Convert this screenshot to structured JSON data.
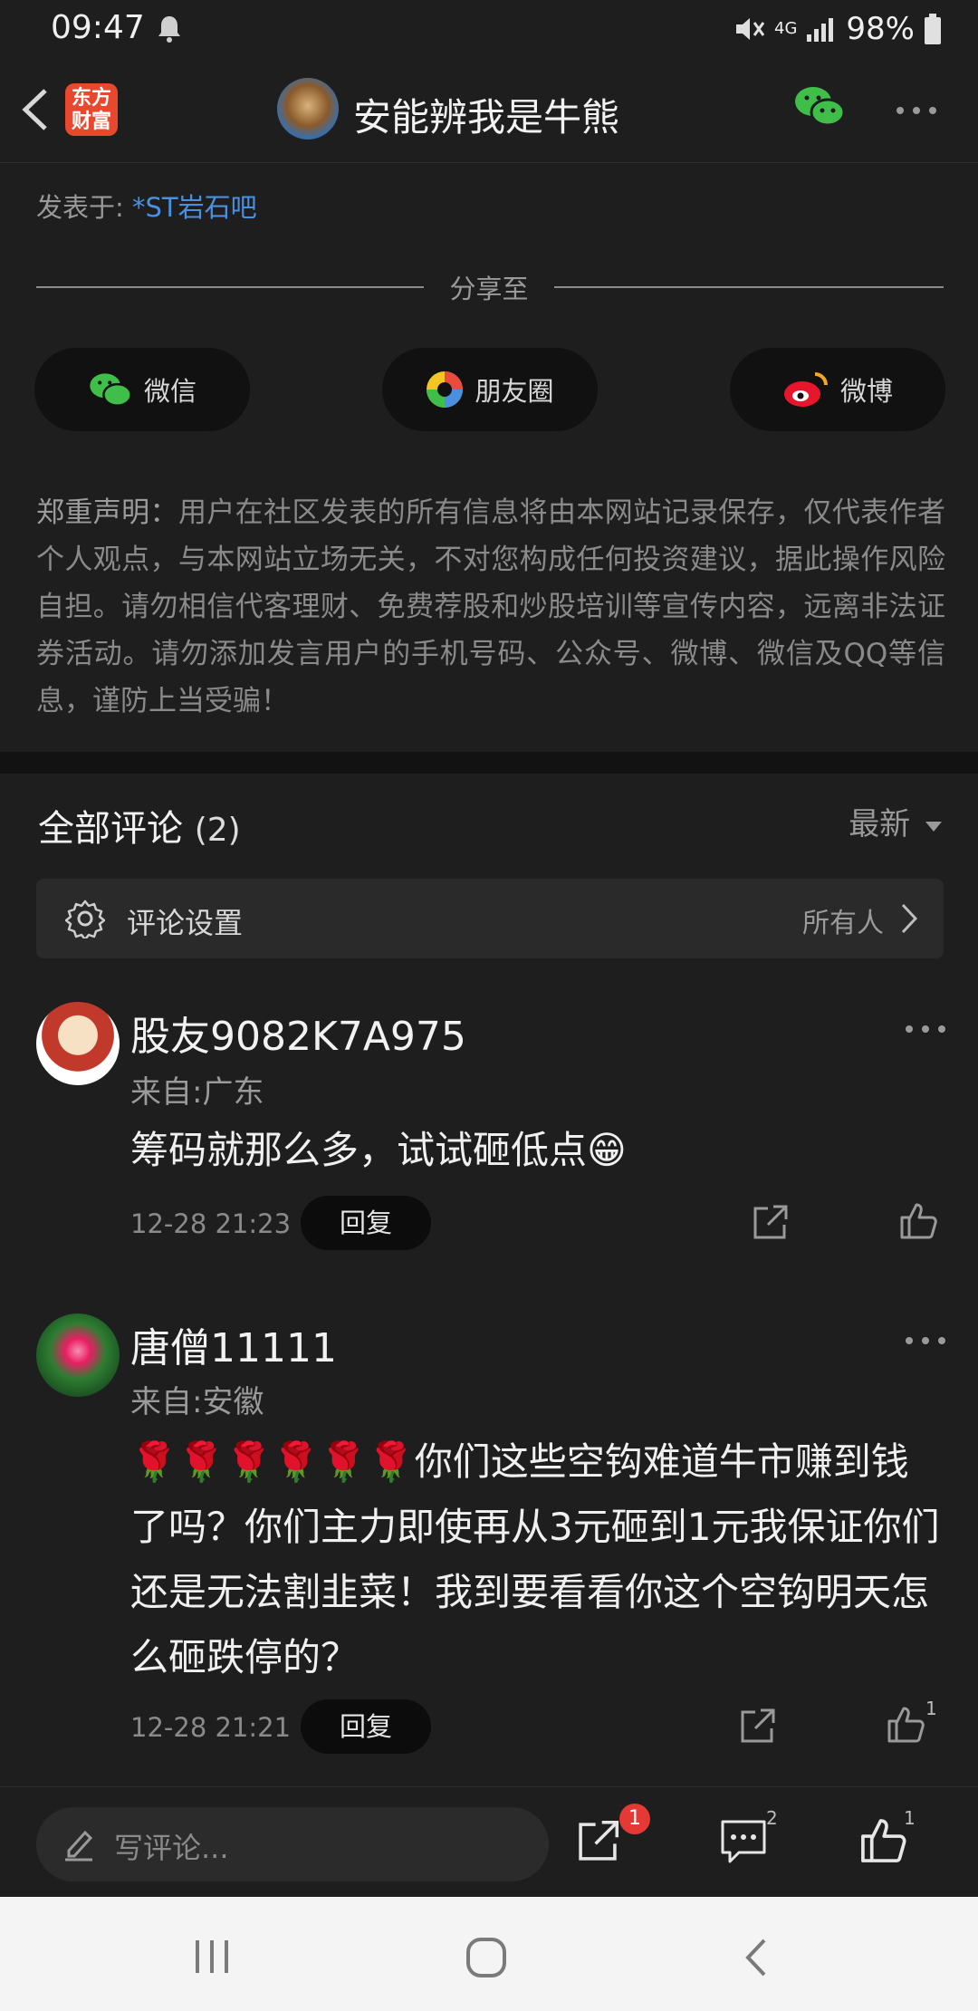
{
  "status": {
    "time": "09:47",
    "network": "4G",
    "battery": "98%"
  },
  "header": {
    "logo_line1": "东方",
    "logo_line2": "财富",
    "title": "安能辨我是牛熊"
  },
  "post": {
    "posted_label": "发表于:",
    "bar_name": "*ST岩石吧"
  },
  "share": {
    "label": "分享至",
    "buttons": [
      {
        "label": "微信",
        "icon": "wechat-icon"
      },
      {
        "label": "朋友圈",
        "icon": "moments-icon"
      },
      {
        "label": "微博",
        "icon": "weibo-icon"
      }
    ]
  },
  "disclaimer": {
    "head": "郑重声明：",
    "body": "用户在社区发表的所有信息将由本网站记录保存，仅代表作者个人观点，与本网站立场无关，不对您构成任何投资建议，据此操作风险自担。请勿相信代客理财、免费荐股和炒股培训等宣传内容，远离非法证券活动。请勿添加发言用户的手机号码、公众号、微博、微信及QQ等信息，谨防上当受骗！"
  },
  "comments": {
    "title": "全部评论",
    "count": "(2)",
    "sort": "最新",
    "settings_label": "评论设置",
    "settings_value": "所有人",
    "items": [
      {
        "name": "股友9082K7A975",
        "location": "来自:广东",
        "text": "筹码就那么多，试试砸低点😁",
        "time": "12-28 21:23",
        "reply": "回复",
        "likes": ""
      },
      {
        "name": "唐僧11111",
        "location": "来自:安徽",
        "text": "🌹🌹🌹🌹🌹🌹你们这些空钩难道牛市赚到钱了吗？你们主力即使再从3元砸到1元我保证你们还是无法割韭菜！我到要看看你这个空钩明天怎么砸跌停的？",
        "time": "12-28 21:21",
        "reply": "回复",
        "likes": "1"
      }
    ]
  },
  "bottom": {
    "placeholder": "写评论...",
    "share_badge": "1",
    "comment_count": "2",
    "like_count": "1"
  },
  "colors": {
    "accent": "#4a90e2",
    "brand": "#e8482e",
    "badge": "#e53935",
    "wechat": "#3fbf4a"
  }
}
